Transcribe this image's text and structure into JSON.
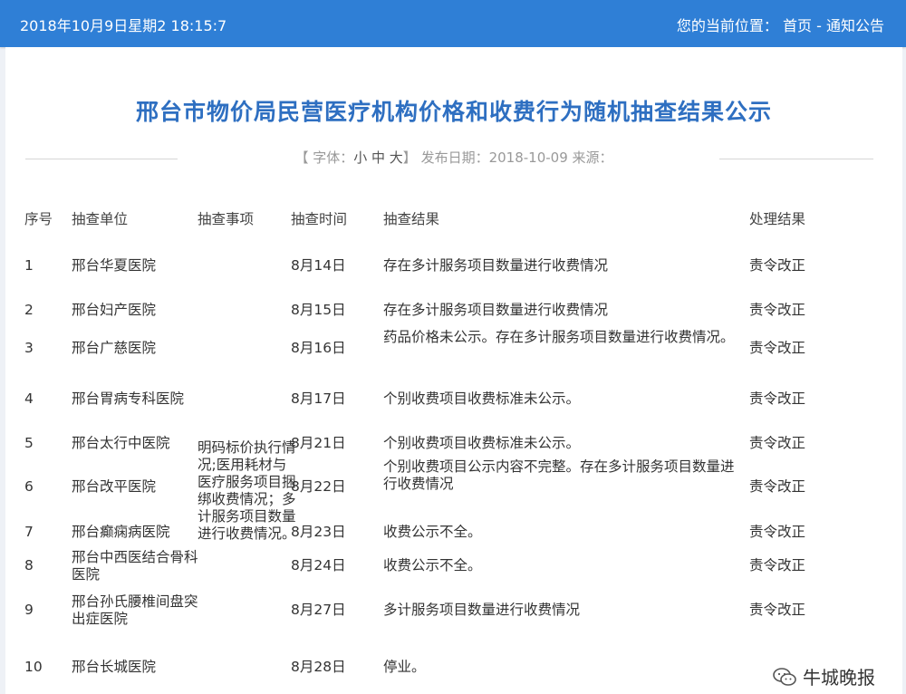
{
  "header": {
    "datetime": "2018年10月9日星期2 18:15:7",
    "location_label": "您的当前位置：",
    "home": "首页",
    "separator": " - ",
    "section": "通知公告"
  },
  "article": {
    "title": "邢台市物价局民营医疗机构价格和收费行为随机抽查结果公示",
    "font_prefix": "【 字体：",
    "font_sizes": "小 中 大",
    "font_suffix": "】",
    "publish_label": "发布日期：",
    "publish_date": "2018-10-09",
    "source_label": "来源："
  },
  "table": {
    "headers": [
      "序号",
      "抽查单位",
      "抽查事项",
      "抽查时间",
      "抽查结果",
      "处理结果"
    ],
    "merged_item": "明码标价执行情况;医用耗材与医疗服务项目捆绑收费情况；多计服务项目数量进行收费情况。",
    "rows": [
      {
        "no": "1",
        "unit": "邢台华夏医院",
        "time": "8月14日",
        "result": "存在多计服务项目数量进行收费情况",
        "handling": "责令改正"
      },
      {
        "no": "2",
        "unit": "邢台妇产医院",
        "time": "8月15日",
        "result": "存在多计服务项目数量进行收费情况",
        "handling": "责令改正"
      },
      {
        "no": "3",
        "unit": "邢台广慈医院",
        "time": "8月16日",
        "result": "药品价格未公示。存在多计服务项目数量进行收费情况。",
        "handling": "责令改正"
      },
      {
        "no": "4",
        "unit": "邢台胃病专科医院",
        "time": "8月17日",
        "result": "个别收费项目收费标准未公示。",
        "handling": "责令改正"
      },
      {
        "no": "5",
        "unit": "邢台太行中医院",
        "time": "8月21日",
        "result": "个别收费项目收费标准未公示。",
        "handling": "责令改正"
      },
      {
        "no": "6",
        "unit": "邢台改平医院",
        "time": "8月22日",
        "result": "个别收费项目公示内容不完整。存在多计服务项目数量进行收费情况",
        "handling": "责令改正"
      },
      {
        "no": "7",
        "unit": "邢台癫痫病医院",
        "time": "8月23日",
        "result": "收费公示不全。",
        "handling": "责令改正"
      },
      {
        "no": "8",
        "unit": "邢台中西医结合骨科医院",
        "time": "8月24日",
        "result": "收费公示不全。",
        "handling": "责令改正"
      },
      {
        "no": "9",
        "unit": "邢台孙氏腰椎间盘突出症医院",
        "time": "8月27日",
        "result": "多计服务项目数量进行收费情况",
        "handling": "责令改正"
      },
      {
        "no": "10",
        "unit": "邢台长城医院",
        "time": "8月28日",
        "result": "停业。",
        "handling": ""
      }
    ]
  },
  "watermark": {
    "icon": "wechat-icon",
    "text": "牛城晚报"
  }
}
